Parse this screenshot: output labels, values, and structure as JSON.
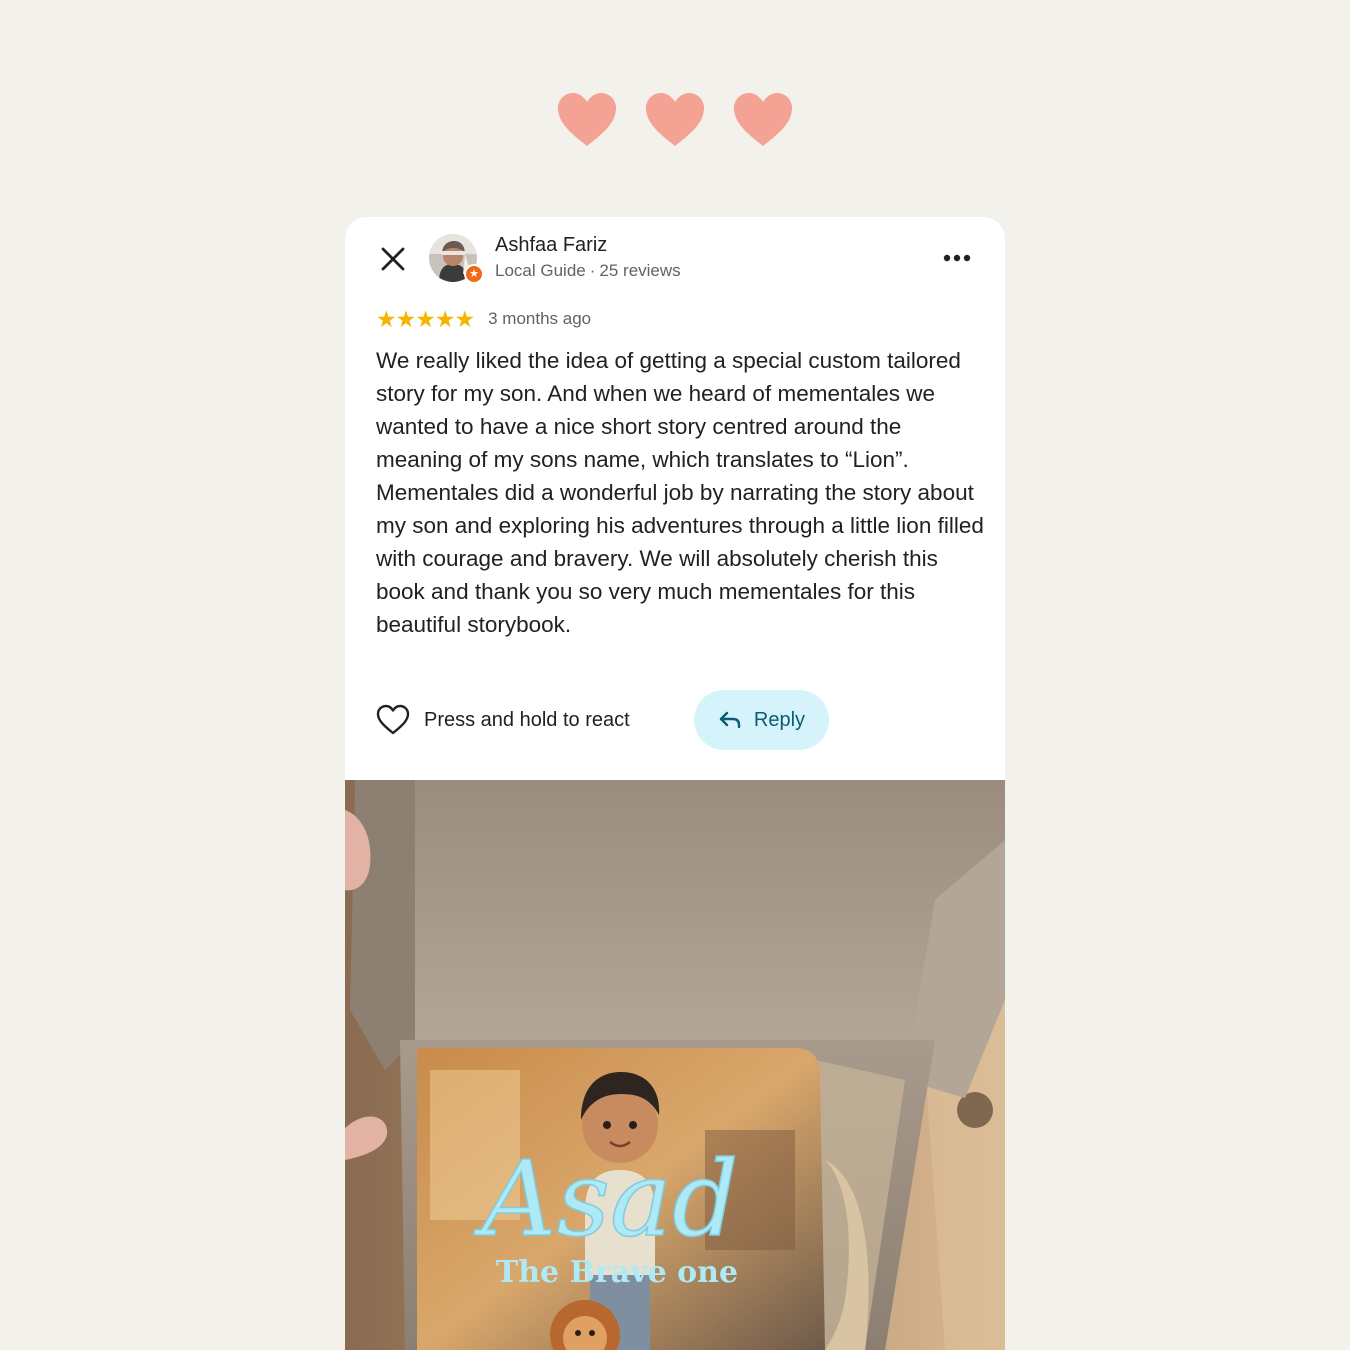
{
  "decor": {
    "heart_color": "#f4a293",
    "heart_count": 3
  },
  "review": {
    "author_name": "Ashfaa Fariz",
    "author_role": "Local Guide",
    "author_reviews": "25 reviews",
    "rating": 5,
    "stars": "★★★★★",
    "time_ago": "3 months ago",
    "text": "We really liked the idea of getting a special custom tailored story for my son. And when we heard of mementales we wanted to have a nice short story centred around the meaning of my sons name, which translates to “Lion”. Mementales did a wonderful job by narrating the story about my son and exploring his adventures through a little lion filled with courage and bravery. We will absolutely cherish this book and thank you so very much mementales for this beautiful storybook."
  },
  "actions": {
    "react_label": "Press and hold to react",
    "reply_label": "Reply"
  },
  "photo": {
    "book_title": "Asad",
    "book_subtitle": "The Brave one"
  },
  "colors": {
    "background": "#f3f1ec",
    "star": "#f6b400",
    "reply_bg": "#d4f3fb",
    "reply_text": "#0b5c6f",
    "badge": "#f06a16"
  },
  "icons": [
    "close-icon",
    "more-icon",
    "local-guide-star-icon",
    "heart-outline-icon",
    "reply-arrow-icon",
    "heart-icon"
  ]
}
